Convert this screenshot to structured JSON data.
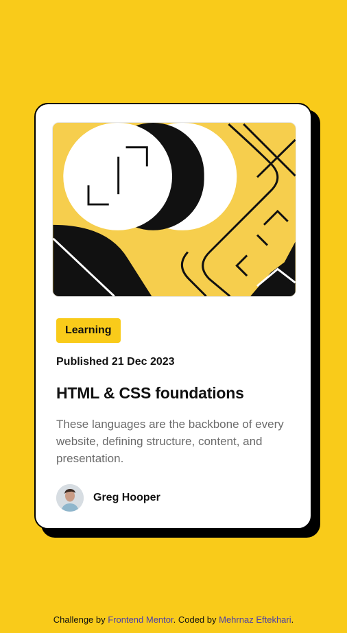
{
  "card": {
    "category": "Learning",
    "published": "Published 21 Dec 2023",
    "title": "HTML & CSS foundations",
    "description": "These languages are the backbone of every website, defining structure, content, and presentation.",
    "author": {
      "name": "Greg Hooper"
    }
  },
  "footer": {
    "prefix": "Challenge by ",
    "link1": "Frontend Mentor",
    "middle": ". Coded by ",
    "link2": "Mehrnaz Eftekhari",
    "suffix": "."
  },
  "colors": {
    "background": "#f9cb1a",
    "card": "#ffffff",
    "border": "#000000",
    "text": "#111111",
    "muted": "#6b6b6b",
    "link": "#4b3fa6"
  }
}
